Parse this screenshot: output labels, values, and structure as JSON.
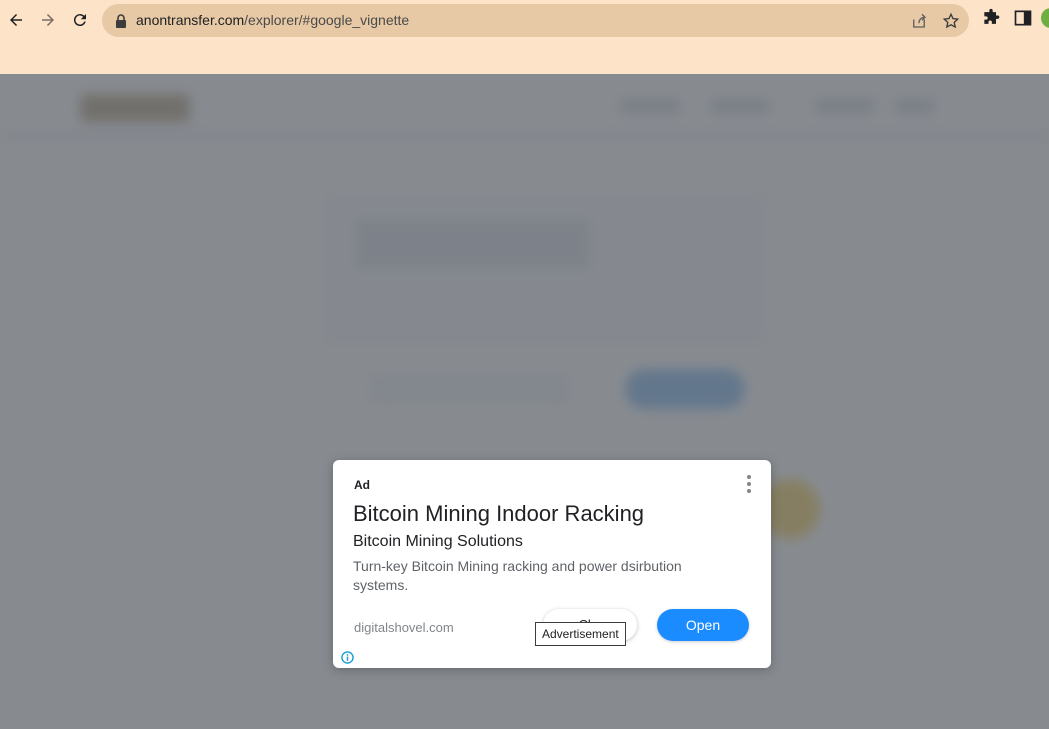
{
  "browser": {
    "url_domain": "anontransfer.com",
    "url_path": "/explorer/#google_vignette",
    "icons": [
      "back-icon",
      "forward-icon",
      "reload-icon",
      "lock-icon",
      "share-icon",
      "star-icon",
      "puzzle-icon",
      "side-panel-icon"
    ]
  },
  "ad": {
    "label": "Ad",
    "title": "Bitcoin Mining Indoor Racking",
    "subtitle": "Bitcoin Mining Solutions",
    "description": "Turn-key Bitcoin Mining racking and power dsirbution systems.",
    "domain": "digitalshovel.com",
    "close_label": "Cl...",
    "open_label": "Open",
    "tooltip": "Advertisement",
    "colors": {
      "open_button": "#1a8cff",
      "overlay": "#6c7278"
    }
  }
}
